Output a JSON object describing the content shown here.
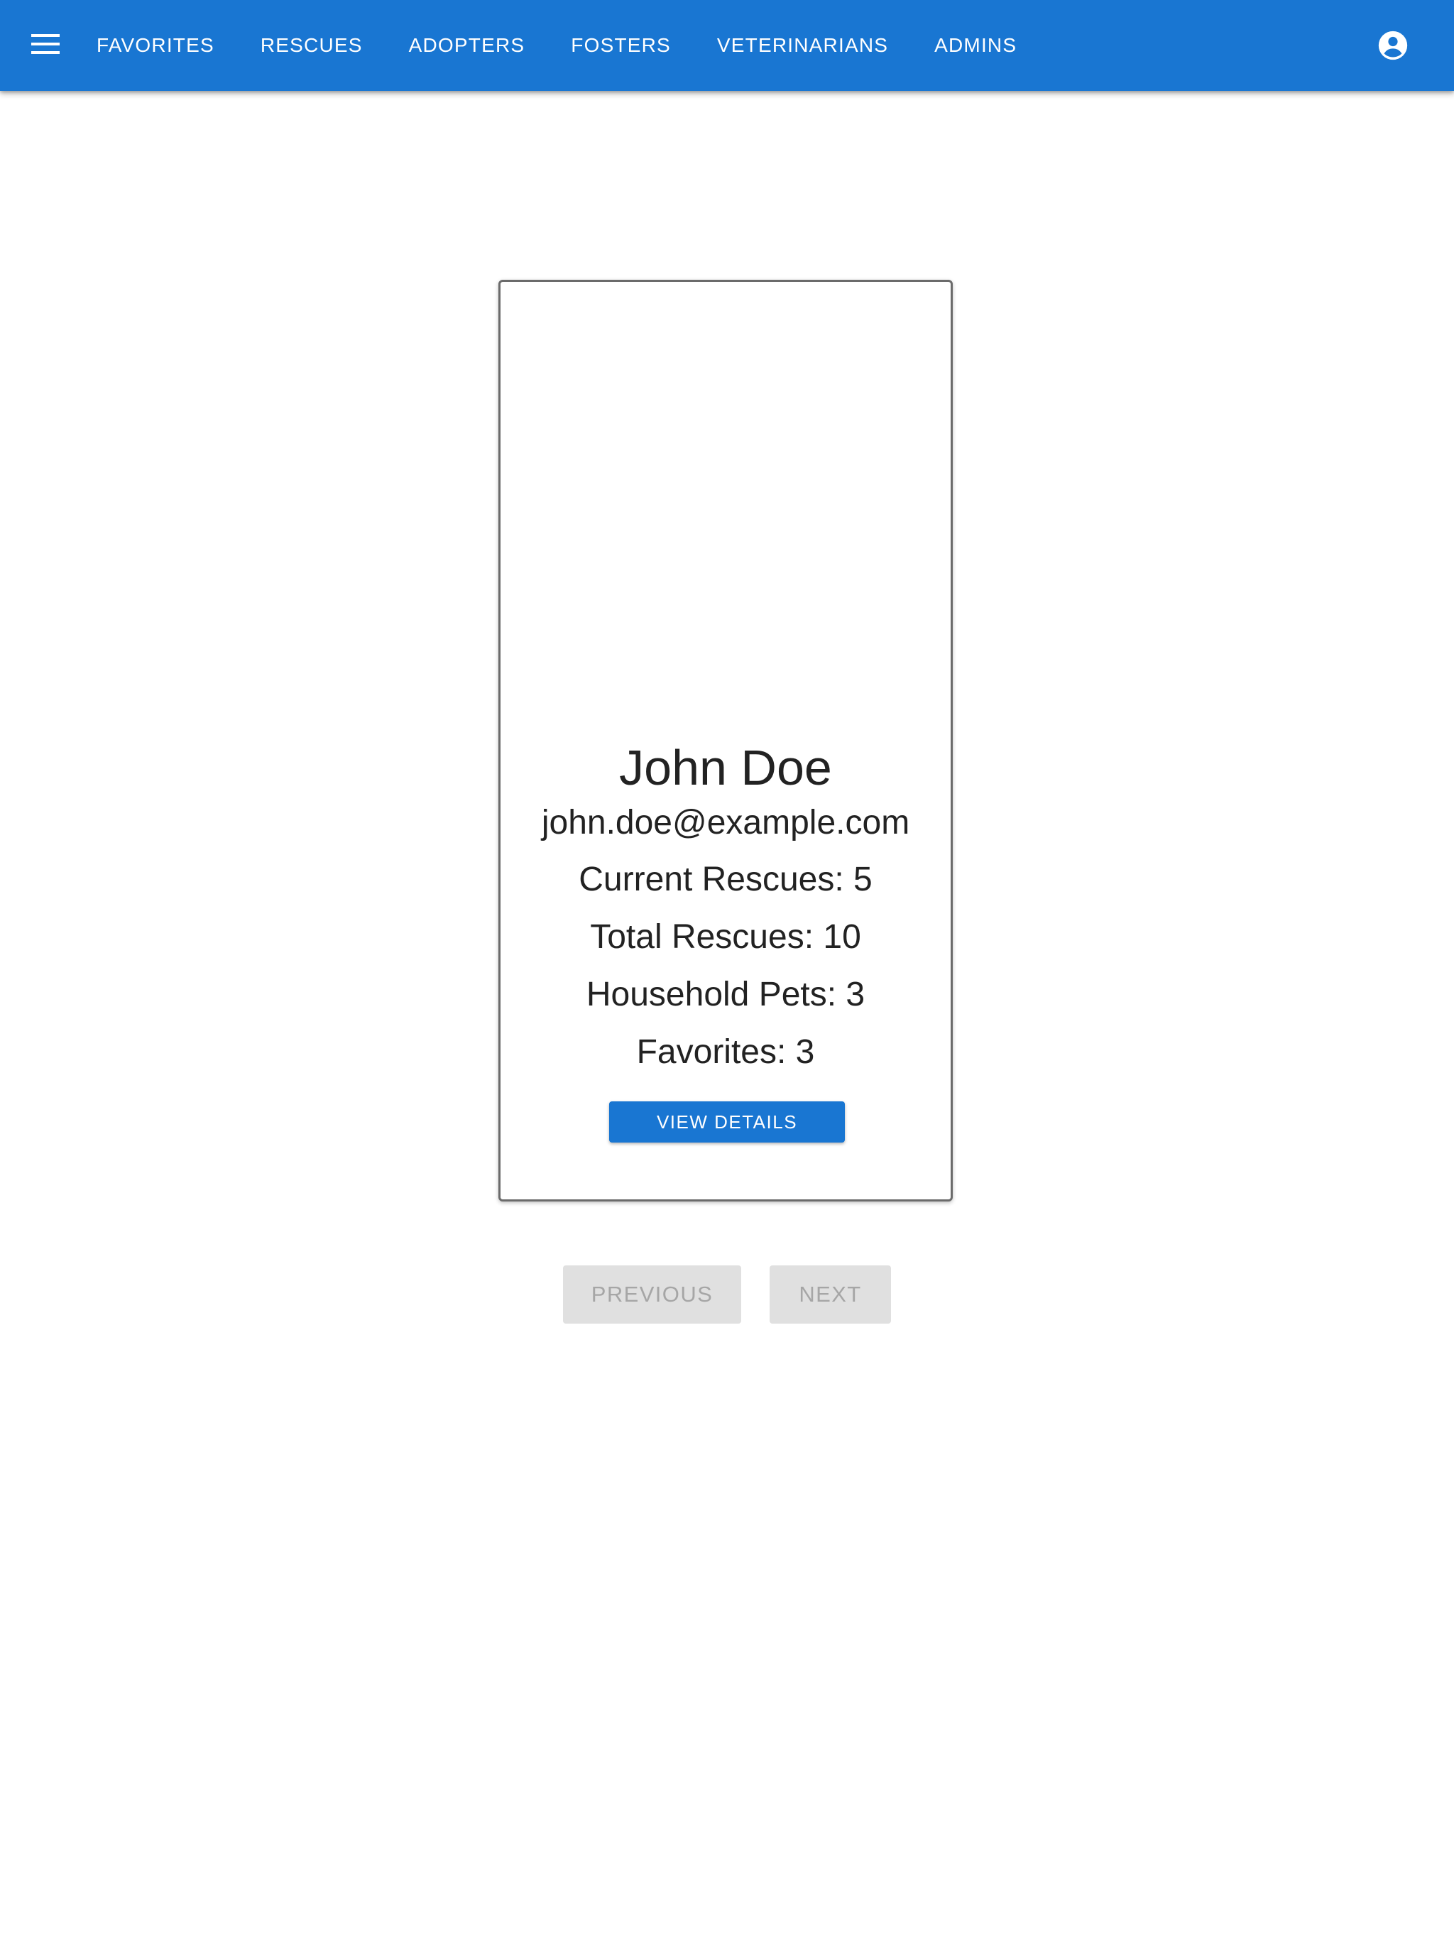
{
  "appbar": {
    "nav": [
      {
        "label": "FAVORITES"
      },
      {
        "label": "RESCUES"
      },
      {
        "label": "ADOPTERS"
      },
      {
        "label": "FOSTERS"
      },
      {
        "label": "VETERINARIANS"
      },
      {
        "label": "ADMINS"
      }
    ],
    "menu_icon": "menu-icon",
    "account_icon": "account-circle-icon",
    "color": "#1976d2"
  },
  "card": {
    "name": "John Doe",
    "email": "john.doe@example.com",
    "current_rescues": "Current Rescues: 5",
    "total_rescues": "Total Rescues: 10",
    "household_pets": "Household Pets: 3",
    "favorites": "Favorites: 3",
    "view_details_label": "VIEW DETAILS"
  },
  "pagination": {
    "previous_label": "PREVIOUS",
    "next_label": "NEXT",
    "disabled_color": "#e0e0e0"
  }
}
